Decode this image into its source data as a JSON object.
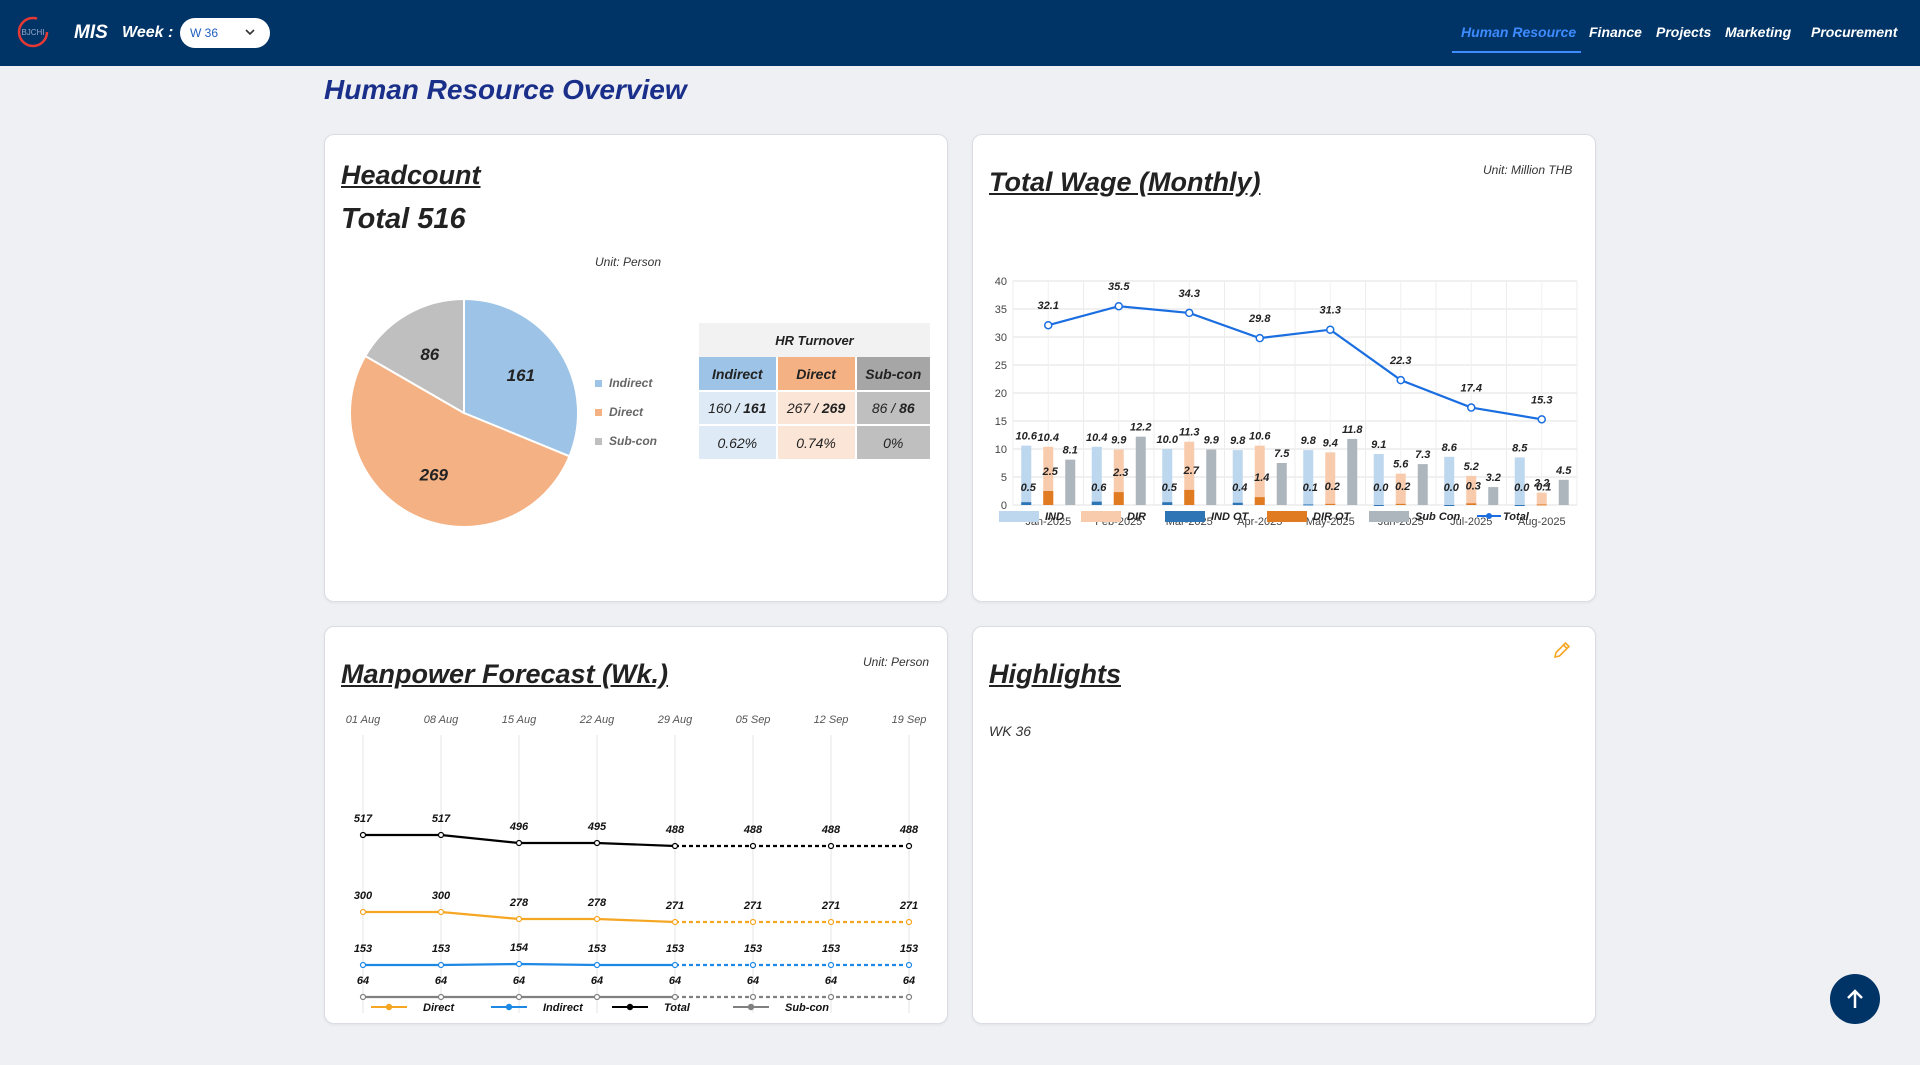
{
  "header": {
    "brand": "MIS",
    "logo_text": "BJCHI",
    "week_label": "Week :",
    "week_value": "W 36",
    "nav": [
      {
        "label": "Human Resource",
        "active": true
      },
      {
        "label": "Finance",
        "active": false
      },
      {
        "label": "Projects",
        "active": false
      },
      {
        "label": "Marketing",
        "active": false
      },
      {
        "label": "Procurement",
        "active": false
      }
    ]
  },
  "page_title": "Human Resource Overview",
  "headcount": {
    "title": "Headcount",
    "total_label": "Total 516",
    "unit": "Unit: Person",
    "turnover": {
      "title": "HR Turnover",
      "columns": [
        "Indirect",
        "Direct",
        "Sub-con"
      ],
      "counts": [
        {
          "left": "160",
          "right": "161"
        },
        {
          "left": "267",
          "right": "269"
        },
        {
          "left": "86",
          "right": "86"
        }
      ],
      "rates": [
        "0.62%",
        "0.74%",
        "0%"
      ]
    }
  },
  "wage": {
    "title": "Total Wage (Monthly)",
    "unit": "Unit: Million THB"
  },
  "forecast": {
    "title": "Manpower Forecast (Wk.)",
    "unit": "Unit: Person"
  },
  "highlights": {
    "title": "Highlights",
    "text": "WK 36"
  },
  "colors": {
    "navy": "#003366",
    "indirect": "#9dc3e6",
    "direct": "#f4b183",
    "subcon": "#bfbfbf",
    "ind_ot": "#2e75b6",
    "dir_ot": "#e07b22",
    "total_line": "#1a6ee0",
    "forecast_direct": "#f5a623",
    "forecast_indirect": "#1e88e5",
    "forecast_total": "#000000",
    "forecast_subcon": "#808080"
  },
  "chart_data": [
    {
      "type": "pie",
      "categories": [
        "Indirect",
        "Direct",
        "Sub-con"
      ],
      "values": [
        161,
        269,
        86
      ],
      "colors": [
        "#9dc3e6",
        "#f4b183",
        "#bfbfbf"
      ],
      "legend_position": "right"
    },
    {
      "type": "bar",
      "categories": [
        "Jan-2025",
        "Feb-2025",
        "Mar-2025",
        "Apr-2025",
        "May-2025",
        "Jun-2025",
        "Jul-2025",
        "Aug-2025"
      ],
      "ylim": [
        0,
        40
      ],
      "yticks": [
        0,
        5,
        10,
        15,
        20,
        25,
        30,
        35,
        40
      ],
      "grid": true,
      "legend_position": "bottom",
      "series": [
        {
          "name": "IND",
          "type": "bar",
          "values": [
            10.6,
            10.4,
            10.0,
            9.8,
            9.8,
            9.1,
            8.6,
            8.5
          ]
        },
        {
          "name": "DIR",
          "type": "bar",
          "values": [
            10.4,
            9.9,
            11.3,
            10.6,
            9.4,
            5.6,
            5.2,
            2.2
          ]
        },
        {
          "name": "IND OT",
          "type": "bar",
          "values": [
            0.5,
            0.6,
            0.5,
            0.4,
            0.1,
            0.0,
            0.0,
            0.0
          ]
        },
        {
          "name": "DIR OT",
          "type": "bar",
          "values": [
            2.5,
            2.3,
            2.7,
            1.4,
            0.2,
            0.2,
            0.3,
            0.1
          ]
        },
        {
          "name": "Sub Con",
          "type": "bar",
          "values": [
            8.1,
            12.2,
            9.9,
            7.5,
            11.8,
            7.3,
            3.2,
            4.5
          ]
        },
        {
          "name": "Total",
          "type": "line",
          "values": [
            32.1,
            35.5,
            34.3,
            29.8,
            31.3,
            22.3,
            17.4,
            15.3
          ]
        }
      ]
    },
    {
      "type": "line",
      "x": [
        "01 Aug",
        "08 Aug",
        "15 Aug",
        "22 Aug",
        "29 Aug",
        "05 Sep",
        "12 Sep",
        "19 Sep"
      ],
      "actual_points": 5,
      "grid": true,
      "legend_position": "bottom",
      "series": [
        {
          "name": "Total",
          "values": [
            517,
            517,
            496,
            495,
            488,
            488,
            488,
            488
          ]
        },
        {
          "name": "Direct",
          "values": [
            300,
            300,
            278,
            278,
            271,
            271,
            271,
            271
          ]
        },
        {
          "name": "Indirect",
          "values": [
            153,
            153,
            154,
            153,
            153,
            153,
            153,
            153
          ]
        },
        {
          "name": "Sub-con",
          "values": [
            64,
            64,
            64,
            64,
            64,
            64,
            64,
            64
          ]
        }
      ],
      "legend_order": [
        "Direct",
        "Indirect",
        "Total",
        "Sub-con"
      ]
    }
  ]
}
